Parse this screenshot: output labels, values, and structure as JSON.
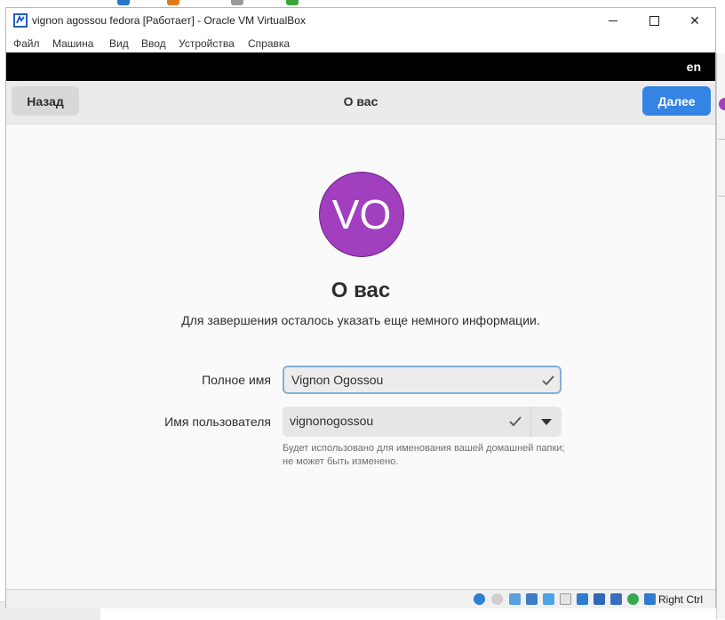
{
  "window": {
    "title": "vignon agossou fedora [Работает] - Oracle VM VirtualBox",
    "controls": {
      "minimize": "—",
      "maximize": "☐",
      "close": "✕"
    }
  },
  "menubar": {
    "items": [
      "Файл",
      "Машина",
      "Вид",
      "Ввод",
      "Устройства",
      "Справка"
    ]
  },
  "guest": {
    "top_bar": {
      "keyboard_layout": "en"
    },
    "header": {
      "back_label": "Назад",
      "title": "О вас",
      "next_label": "Далее"
    },
    "avatar": {
      "initials": "VO",
      "color": "#a23fbf"
    },
    "heading": "О вас",
    "description": "Для завершения осталось указать еще немного информации.",
    "form": {
      "fullname_label": "Полное имя",
      "fullname_value": "Vignon Ogossou",
      "username_label": "Имя пользователя",
      "username_value": "vignonogossou",
      "username_hint": "Будет использовано для именования вашей домашней папки; не может быть изменено."
    }
  },
  "statusbar": {
    "host_key": "Right Ctrl",
    "icons": [
      "hard-disk-icon",
      "optical-drive-icon",
      "audio-icon",
      "network-icon",
      "usb-icon",
      "shared-folders-icon",
      "display-icon",
      "recording-icon",
      "cpu-icon",
      "virtualization-icon",
      "mouse-integration-icon",
      "keyboard-capture-icon"
    ]
  },
  "colors": {
    "accent": "#3584e4",
    "avatar": "#a23fbf",
    "topbar": "#000000",
    "focus_border": "#84aedb"
  }
}
